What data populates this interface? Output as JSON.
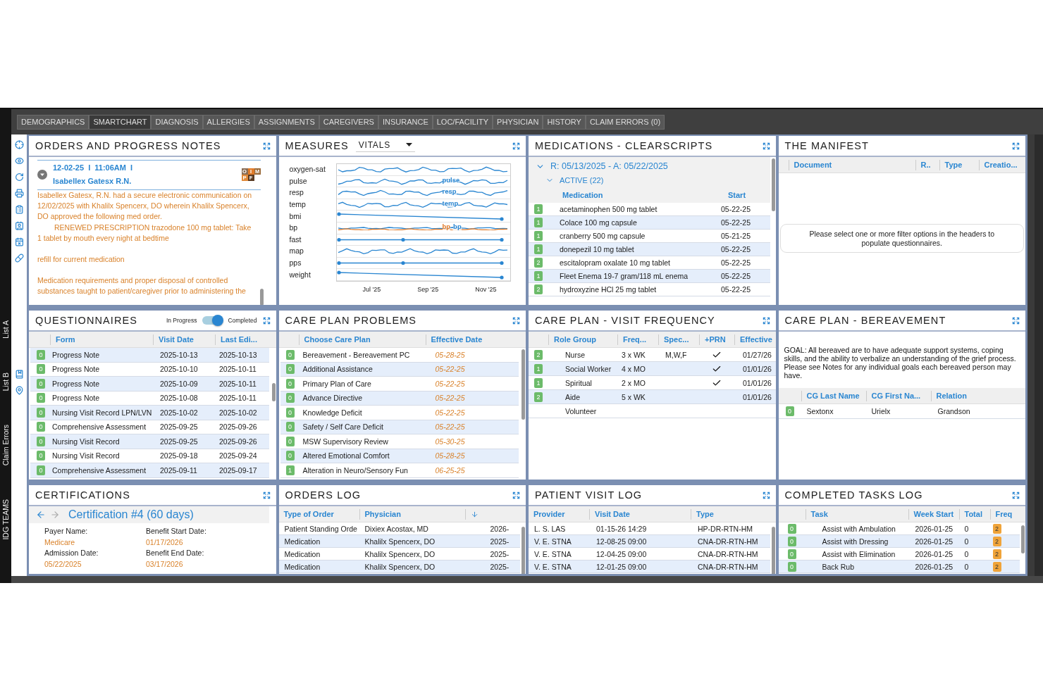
{
  "side_tabs": [
    "List A",
    "List B",
    "Claim Errors",
    "IDG TEAMS"
  ],
  "tabs": [
    {
      "label": "DEMOGRAPHICS",
      "selected": false
    },
    {
      "label": "SMARTCHART",
      "selected": true
    },
    {
      "label": "DIAGNOSIS",
      "selected": false
    },
    {
      "label": "ALLERGIES",
      "selected": false
    },
    {
      "label": "ASSIGNMENTS",
      "selected": false
    },
    {
      "label": "CAREGIVERS",
      "selected": false
    },
    {
      "label": "INSURANCE",
      "selected": false
    },
    {
      "label": "LOC/FACILITY",
      "selected": false
    },
    {
      "label": "PHYSICIAN",
      "selected": false
    },
    {
      "label": "HISTORY",
      "selected": false
    },
    {
      "label": "CLAIM ERRORS (0)",
      "selected": false
    }
  ],
  "orders_notes": {
    "title": "ORDERS AND PROGRESS NOTES",
    "note": {
      "expanded": true,
      "date": "12-02-25  I  11:06AM  I",
      "author": "Isabellex Gatesx R.N.",
      "logo_letters": [
        "O",
        "I",
        "M",
        "P",
        "F"
      ],
      "blocks": [
        [
          {
            "text": "Isabellex Gatesx, R.N. had a secure electronic communication on 12/02/2025 with Khalilx Spencerx,  DO wherein Khalilx Spencerx, DO approved the following med order.",
            "indent": false
          },
          {
            "text": "RENEWED PRESCRIPTION trazodone 100 mg tablet: Take 1 tablet by mouth every night at bedtime",
            "indent": true
          }
        ],
        [
          {
            "text": "refill for current medication",
            "indent": false
          }
        ],
        [
          {
            "text": "Medication requirements and proper disposal of controlled substances taught to patient/caregiver prior to administering the",
            "indent": false
          }
        ]
      ]
    }
  },
  "measures": {
    "title": "MEASURES",
    "selector": "VITALS",
    "rows": [
      {
        "label": "oxygen-sat",
        "kind": "wave"
      },
      {
        "label": "pulse",
        "kind": "wave",
        "tags": [
          {
            "text": "pulse",
            "color": "#2a86d1"
          }
        ]
      },
      {
        "label": "resp",
        "kind": "wave",
        "tags": [
          {
            "text": "resp",
            "color": "#2a86d1"
          }
        ]
      },
      {
        "label": "temp",
        "kind": "wave",
        "tags": [
          {
            "text": "temp",
            "color": "#2a86d1"
          }
        ]
      },
      {
        "label": "bmi",
        "kind": "trend"
      },
      {
        "label": "bp",
        "kind": "double",
        "tags": [
          {
            "text": "bp",
            "color": "#e07b2a"
          },
          {
            "text": "bp",
            "color": "#2a86d1"
          }
        ]
      },
      {
        "label": "fast",
        "kind": "steady"
      },
      {
        "label": "map",
        "kind": "wave"
      },
      {
        "label": "pps",
        "kind": "steady"
      },
      {
        "label": "weight",
        "kind": "trend"
      }
    ],
    "x_labels": [
      "Jul '25",
      "Sep '25",
      "Nov '25"
    ]
  },
  "medications": {
    "title": "MEDICATIONS - CLEARSCRIPTS",
    "group": {
      "label": "R: 05/13/2025 - A: 05/22/2025",
      "expanded": true
    },
    "subgroup": {
      "label": "ACTIVE (22)",
      "expanded": true
    },
    "columns": [
      "Medication",
      "Start"
    ],
    "rows": [
      {
        "badge": "1",
        "name": "acetaminophen 500 mg tablet",
        "start": "05-22-25"
      },
      {
        "badge": "1",
        "name": "Colace 100 mg capsule",
        "start": "05-22-25"
      },
      {
        "badge": "1",
        "name": "cranberry 500 mg capsule",
        "start": "05-21-25"
      },
      {
        "badge": "1",
        "name": "donepezil 10 mg tablet",
        "start": "05-22-25"
      },
      {
        "badge": "2",
        "name": "escitalopram oxalate 10 mg tablet",
        "start": "05-22-25"
      },
      {
        "badge": "1",
        "name": "Fleet Enema 19-7 gram/118 mL enema",
        "start": "05-22-25"
      },
      {
        "badge": "2",
        "name": "hydroxyzine HCl 25 mg tablet",
        "start": "05-22-25"
      }
    ]
  },
  "manifest": {
    "title": "THE MANIFEST",
    "columns": [
      "Document",
      "R..",
      "Type",
      "Creatio..."
    ],
    "message": "Please select one or more filter options in the headers to populate questionnaires."
  },
  "questionnaires": {
    "title": "QUESTIONNAIRES",
    "toggle": {
      "left": "In Progress",
      "right": "Completed",
      "on": true
    },
    "columns": [
      "Form",
      "Visit Date",
      "Last Edi..."
    ],
    "rows": [
      {
        "badge": "0",
        "form": "Progress Note",
        "visit": "2025-10-13",
        "edited": "2025-10-13"
      },
      {
        "badge": "0",
        "form": "Progress Note",
        "visit": "2025-10-10",
        "edited": "2025-10-11"
      },
      {
        "badge": "0",
        "form": "Progress Note",
        "visit": "2025-10-09",
        "edited": "2025-10-11"
      },
      {
        "badge": "0",
        "form": "Progress Note",
        "visit": "2025-10-08",
        "edited": "2025-10-11"
      },
      {
        "badge": "0",
        "form": "Nursing Visit Record LPN/LVN",
        "visit": "2025-10-02",
        "edited": "2025-10-02"
      },
      {
        "badge": "0",
        "form": "Comprehensive Assessment",
        "visit": "2025-09-25",
        "edited": "2025-09-26"
      },
      {
        "badge": "0",
        "form": "Nursing Visit Record",
        "visit": "2025-09-25",
        "edited": "2025-09-26"
      },
      {
        "badge": "0",
        "form": "Nursing Visit Record",
        "visit": "2025-09-18",
        "edited": "2025-09-24"
      },
      {
        "badge": "0",
        "form": "Comprehensive Assessment",
        "visit": "2025-09-11",
        "edited": "2025-09-17"
      }
    ]
  },
  "care_plan_problems": {
    "title": "CARE PLAN PROBLEMS",
    "columns": [
      "Choose Care Plan",
      "Effective Date"
    ],
    "rows": [
      {
        "badge": "0",
        "name": "Bereavement - Bereavement PC",
        "date": "05-28-25"
      },
      {
        "badge": "0",
        "name": "Additional Assistance",
        "date": "05-22-25"
      },
      {
        "badge": "0",
        "name": "Primary Plan of Care",
        "date": "05-22-25"
      },
      {
        "badge": "0",
        "name": "Advance Directive",
        "date": "05-22-25"
      },
      {
        "badge": "0",
        "name": "Knowledge Deficit",
        "date": "05-22-25"
      },
      {
        "badge": "0",
        "name": "Safety / Self Care Deficit",
        "date": "05-22-25"
      },
      {
        "badge": "0",
        "name": "MSW Supervisory Review",
        "date": "05-30-25"
      },
      {
        "badge": "0",
        "name": "Altered Emotional Comfort",
        "date": "05-28-25"
      },
      {
        "badge": "1",
        "name": "Alteration in Neuro/Sensory Fun",
        "date": "06-25-25"
      }
    ]
  },
  "visit_frequency": {
    "title": "CARE PLAN - VISIT FREQUENCY",
    "columns": [
      "Role Group",
      "Freq...",
      "Spec...",
      "+PRN",
      "Effective"
    ],
    "rows": [
      {
        "badge": "2",
        "role": "Nurse",
        "freq": "3 x WK",
        "spec": "M,W,F",
        "prn": true,
        "effective": "01/27/26"
      },
      {
        "badge": "1",
        "role": "Social Worker",
        "freq": "4 x MO",
        "prn": true,
        "effective": "01/01/26"
      },
      {
        "badge": "1",
        "role": "Spiritual",
        "freq": "2 x MO",
        "prn": true,
        "effective": "01/01/26"
      },
      {
        "badge": "2",
        "role": "Aide",
        "freq": "5 x WK",
        "prn": false,
        "effective": "01/01/26"
      },
      {
        "role": "Volunteer",
        "prn": false
      }
    ]
  },
  "bereavement": {
    "title": "CARE PLAN - BEREAVEMENT",
    "goal": "GOAL: All bereaved are to have adequate support systems, coping skills, and the ability to verbalize an understanding of the grief process. Please see Notes for any individual goals each bereaved person may have.",
    "columns": [
      "CG Last Name",
      "CG First Na...",
      "Relation"
    ],
    "rows": [
      {
        "badge": "0",
        "last": "Sextonx",
        "first": "Urielx",
        "relation": "Grandson"
      }
    ]
  },
  "certifications": {
    "title": "CERTIFICATIONS",
    "back_enabled": true,
    "forward_enabled": false,
    "heading": "Certification #4 (60 days)",
    "fields": [
      {
        "label": "Payer Name:",
        "value": "Medicare"
      },
      {
        "label": "Benefit Start Date:",
        "value": "01/17/2026"
      },
      {
        "label": "Admission Date:",
        "value": "05/22/2025"
      },
      {
        "label": "Benefit End Date:",
        "value": "03/17/2026"
      }
    ]
  },
  "orders_log": {
    "title": "ORDERS LOG",
    "columns": [
      "Type of Order",
      "Physician"
    ],
    "rows": [
      {
        "type": "Patient Standing Orde",
        "physician": "Dixiex Acostax, MD",
        "date": "2026-"
      },
      {
        "type": "Medication",
        "physician": "Khalilx Spencerx, DO",
        "date": "2025-"
      },
      {
        "type": "Medication",
        "physician": "Khalilx Spencerx, DO",
        "date": "2025-"
      },
      {
        "type": "Medication",
        "physician": "Khalilx Spencerx, DO",
        "date": "2025-"
      }
    ]
  },
  "visit_log": {
    "title": "PATIENT VISIT LOG",
    "columns": [
      "Provider",
      "Visit Date",
      "Type"
    ],
    "rows": [
      {
        "provider": "L. S. LAS",
        "date": "01-15-26 14:29",
        "type": "HP-DR-RTN-HM"
      },
      {
        "provider": "V. E. STNA",
        "date": "12-08-25 09:00",
        "type": "CNA-DR-RTN-HM"
      },
      {
        "provider": "V. E. STNA",
        "date": "12-04-25 09:00",
        "type": "CNA-DR-RTN-HM"
      },
      {
        "provider": "V. E. STNA",
        "date": "12-01-25 09:00",
        "type": "CNA-DR-RTN-HM"
      }
    ]
  },
  "tasks_log": {
    "title": "COMPLETED TASKS LOG",
    "columns": [
      "Task",
      "Week Start",
      "Total",
      "Freq"
    ],
    "rows": [
      {
        "badge": "0",
        "task": "Assist with Ambulation",
        "week": "2026-01-25",
        "total": "0",
        "freq": "2"
      },
      {
        "badge": "0",
        "task": "Assist with Dressing",
        "week": "2026-01-25",
        "total": "0",
        "freq": "2"
      },
      {
        "badge": "0",
        "task": "Assist with Elimination",
        "week": "2026-01-25",
        "total": "0",
        "freq": "2"
      },
      {
        "badge": "0",
        "task": "Back Rub",
        "week": "2026-01-25",
        "total": "0",
        "freq": "2"
      }
    ]
  }
}
